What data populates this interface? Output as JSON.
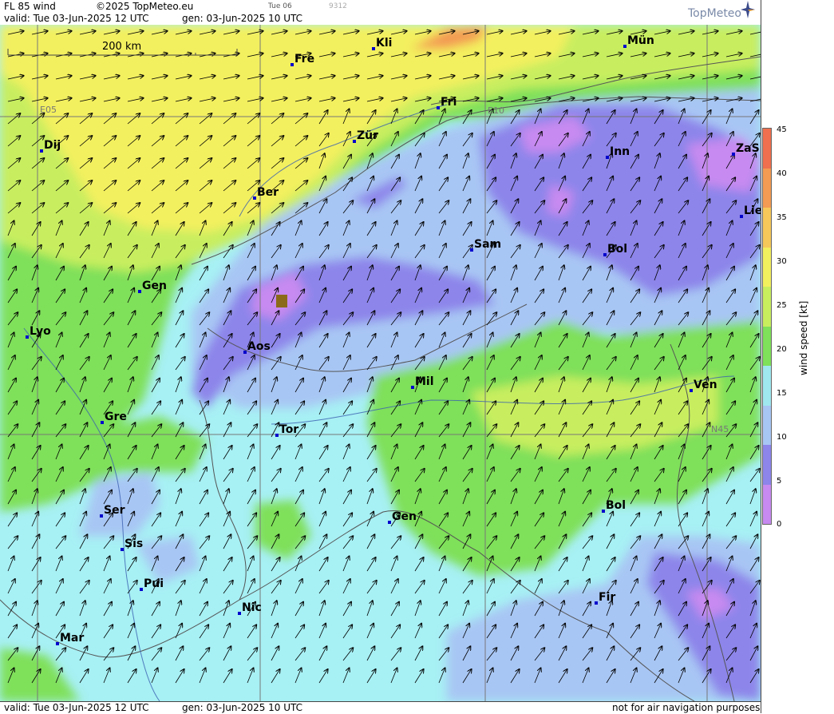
{
  "header": {
    "product": "FL 85 wind",
    "copyright": "©2025 TopMeteo.eu",
    "valid_line": "valid:  Tue  03-Jun-2025  12 UTC",
    "gen_line": "gen: 03-Jun-2025 10 UTC",
    "small_date": "Tue 06",
    "small_code": "9312",
    "logo": "TopMeteo"
  },
  "footer": {
    "valid_line": "valid:  Tue  03-Jun-2025  12 UTC",
    "gen_line": "gen: 03-Jun-2025 10 UTC",
    "disclaimer": "not for air navigation purposes"
  },
  "scale_label": "200 km",
  "grid_labels": [
    "E05",
    "E10",
    "N45"
  ],
  "colorbar": {
    "label": "wind speed [kt]",
    "ticks": [
      "45",
      "40",
      "35",
      "30",
      "25",
      "20",
      "15",
      "10",
      "5",
      "0"
    ],
    "colors": [
      "#ef6f4f",
      "#f39a53",
      "#f6c85a",
      "#f3f05e",
      "#c8ee5e",
      "#7fe05a",
      "#9fe8f0",
      "#a8c6f4",
      "#8d85ea",
      "#c78af0"
    ]
  },
  "cities": [
    "Kli",
    "Fre",
    "Mün",
    "Fri",
    "Dij",
    "Zür",
    "Inn",
    "ZaS",
    "Ber",
    "Lie",
    "Sam",
    "Bol",
    "Gen",
    "Lyo",
    "Aos",
    "Mil",
    "Ven",
    "Gre",
    "Tor",
    "Ser",
    "Gen",
    "Bol",
    "Sis",
    "Pui",
    "Fir",
    "Nic",
    "Mar"
  ]
}
